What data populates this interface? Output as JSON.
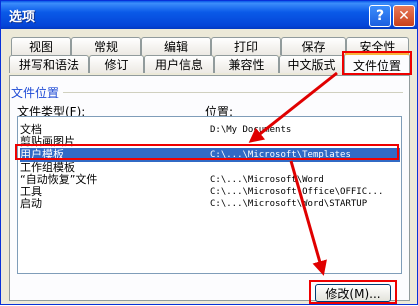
{
  "window": {
    "title": "选项",
    "help_glyph": "?",
    "close_glyph": "✕"
  },
  "tabs_row1": [
    "视图",
    "常规",
    "编辑",
    "打印",
    "保存",
    "安全性"
  ],
  "tabs_row2": [
    "拼写和语法",
    "修订",
    "用户信息",
    "兼容性",
    "中文版式",
    "文件位置"
  ],
  "active_tab": "文件位置",
  "group": {
    "title": "文件位置",
    "col_type": "文件类型(F):",
    "col_location": "位置:"
  },
  "rows": [
    {
      "name": "文档",
      "path": "D:\\My Documents"
    },
    {
      "name": "剪贴画图片",
      "path": ""
    },
    {
      "name": "用户模板",
      "path": "C:\\...\\Microsoft\\Templates",
      "selected": true
    },
    {
      "name": "工作组模板",
      "path": ""
    },
    {
      "name": "“自动恢复”文件",
      "path": "C:\\...\\Microsoft\\Word"
    },
    {
      "name": "工具",
      "path": "C:\\...\\Microsoft Office\\OFFIC..."
    },
    {
      "name": "启动",
      "path": "C:\\...\\Microsoft\\Word\\STARTUP"
    }
  ],
  "modify_button": "修改(M)...",
  "colors": {
    "highlight": "#e00000",
    "selection": "#316ac5"
  }
}
